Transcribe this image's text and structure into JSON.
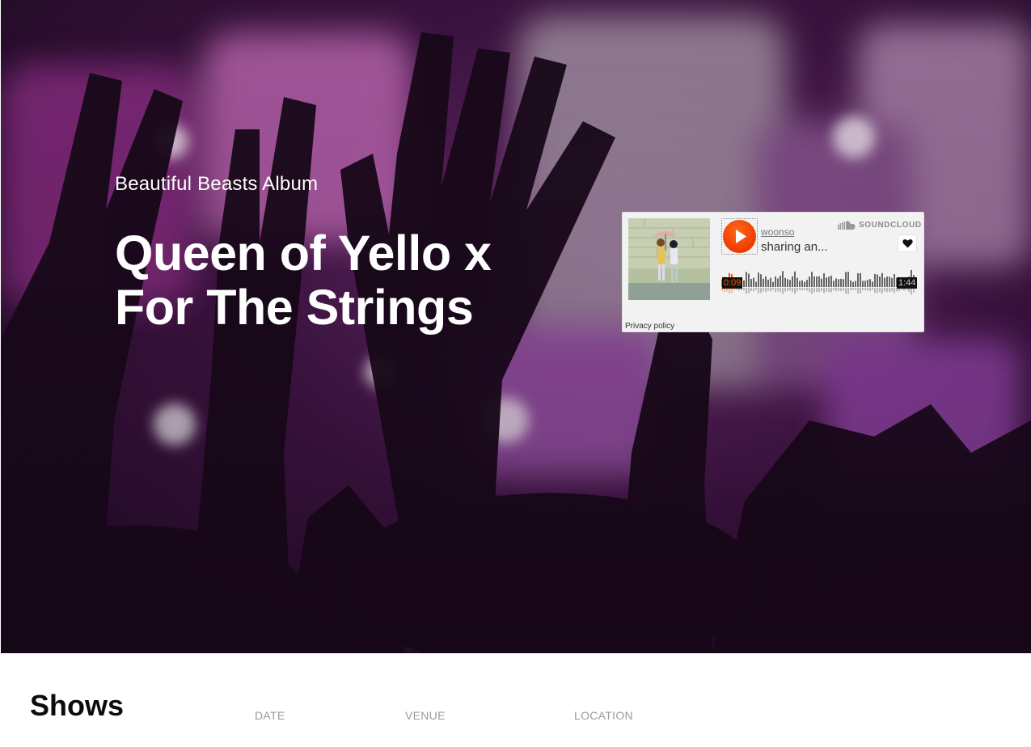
{
  "hero": {
    "subtitle": "Beautiful Beasts Album",
    "title": "Queen of Yello x For The Strings"
  },
  "player": {
    "username": "woonso",
    "track_title": "sharing an...",
    "brand": "SOUNDCLOUD",
    "current_time": "0:09",
    "duration": "1:44",
    "progress": 0.086,
    "privacy_label": "Privacy policy",
    "accent_color": "#ff5500",
    "icons": [
      "play-icon",
      "soundcloud-cloud-icon",
      "heart-icon"
    ]
  },
  "shows": {
    "title": "Shows",
    "columns": [
      "DATE",
      "VENUE",
      "LOCATION"
    ]
  },
  "colors": {
    "hero_tint": "#6a2a6e",
    "text_on_hero": "#ffffff",
    "column_header": "#9a9a9a"
  }
}
